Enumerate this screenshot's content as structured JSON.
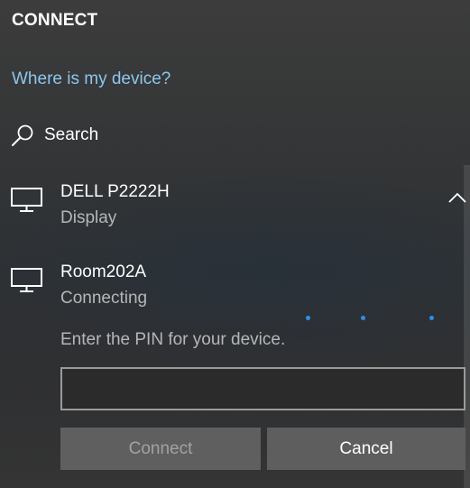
{
  "panel": {
    "title": "CONNECT",
    "help_link": "Where is my device?",
    "search": {
      "label": "Search",
      "icon": "search-icon"
    }
  },
  "devices": [
    {
      "name": "DELL P2222H",
      "status": "Display",
      "icon": "monitor-icon",
      "expanded": true
    },
    {
      "name": "Room202A",
      "status": "Connecting",
      "icon": "monitor-icon",
      "pin_prompt": "Enter the PIN for your device.",
      "pin_value": "",
      "connect_label": "Connect",
      "connect_enabled": false,
      "cancel_label": "Cancel"
    }
  ],
  "colors": {
    "link": "#8cc7ee",
    "progress_accent": "#2f8fe6",
    "secondary_text": "#b6b6b6"
  }
}
